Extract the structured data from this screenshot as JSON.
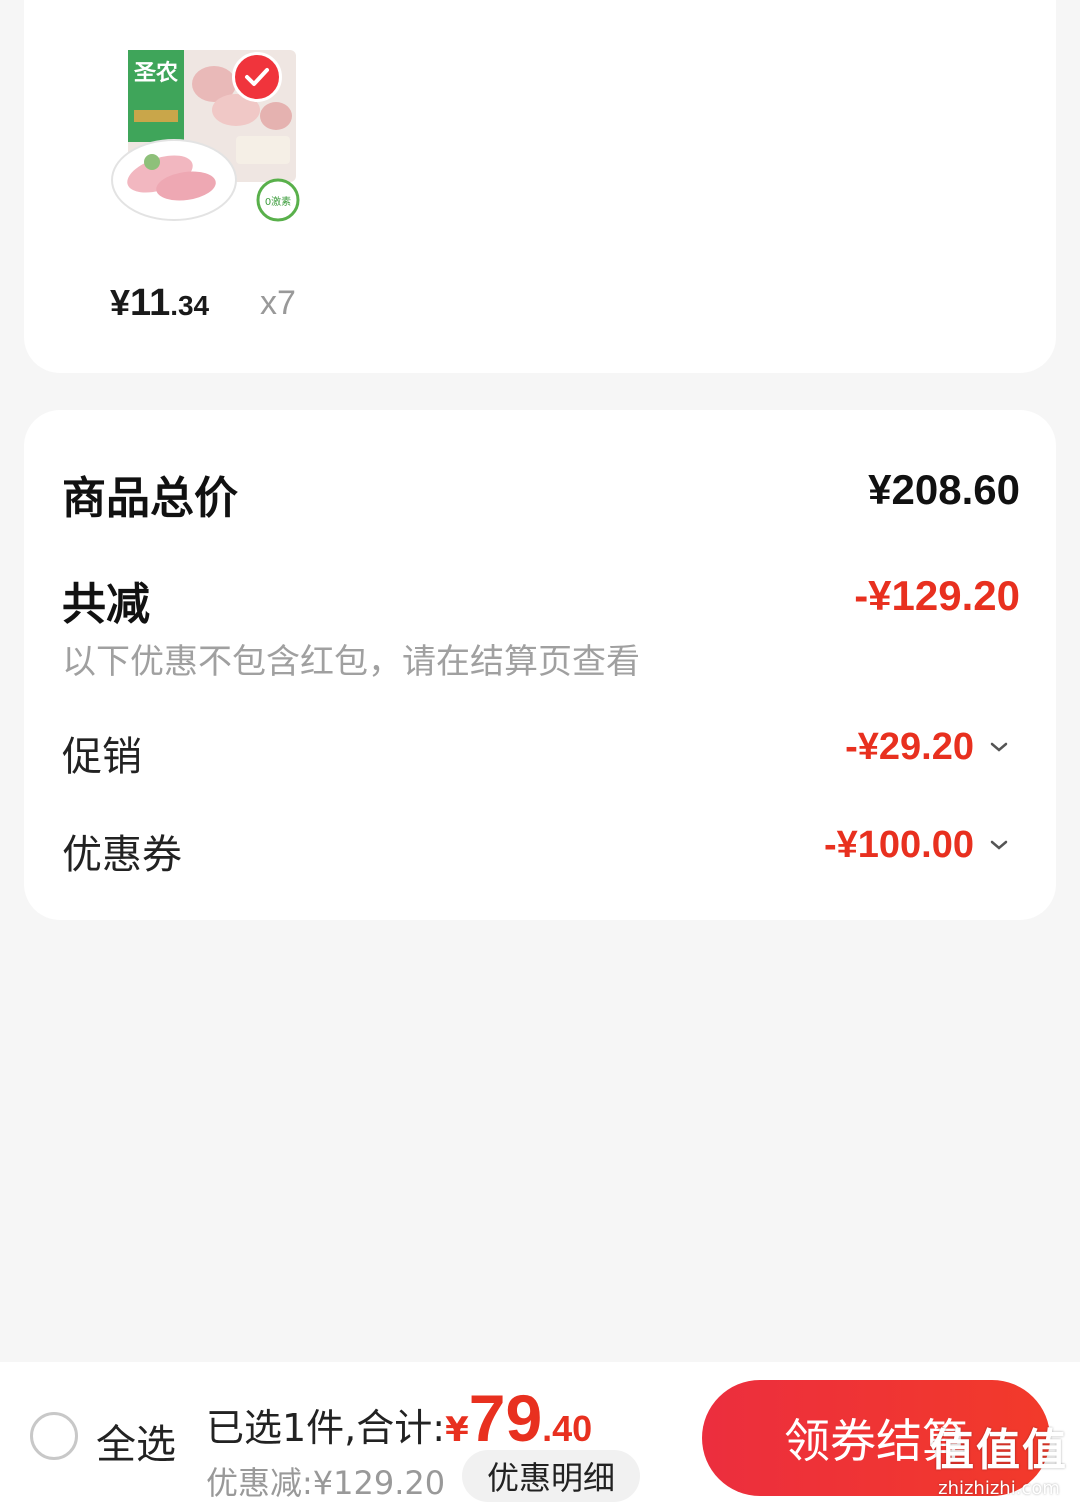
{
  "product": {
    "brand_text": "圣农",
    "badge_text": "0激素",
    "price_yen": "¥",
    "price_int": "11",
    "price_dec": ".34",
    "quantity": "x7",
    "selected": true
  },
  "summary": {
    "total_label": "商品总价",
    "total_value": "¥208.60",
    "reduce_label": "共减",
    "reduce_value": "-¥129.20",
    "note": "以下优惠不包含红包，请在结算页查看",
    "promo_label": "促销",
    "promo_value": "-¥29.20",
    "coupon_label": "优惠券",
    "coupon_value": "-¥100.00"
  },
  "bottom_bar": {
    "select_all_label": "全选",
    "selected_text": "已选1件,合计:",
    "total_yen": "¥",
    "total_int": "79",
    "total_dec": ".40",
    "discount_text": "优惠减:¥129.20",
    "detail_button": "优惠明细",
    "checkout_button": "领券结算"
  },
  "watermark": {
    "main": "值值值",
    "sub": "zhizhizhi.com"
  },
  "colors": {
    "accent_red": "#e8301f",
    "checkout_red": "#ec2e3e",
    "background": "#f6f6f6"
  }
}
